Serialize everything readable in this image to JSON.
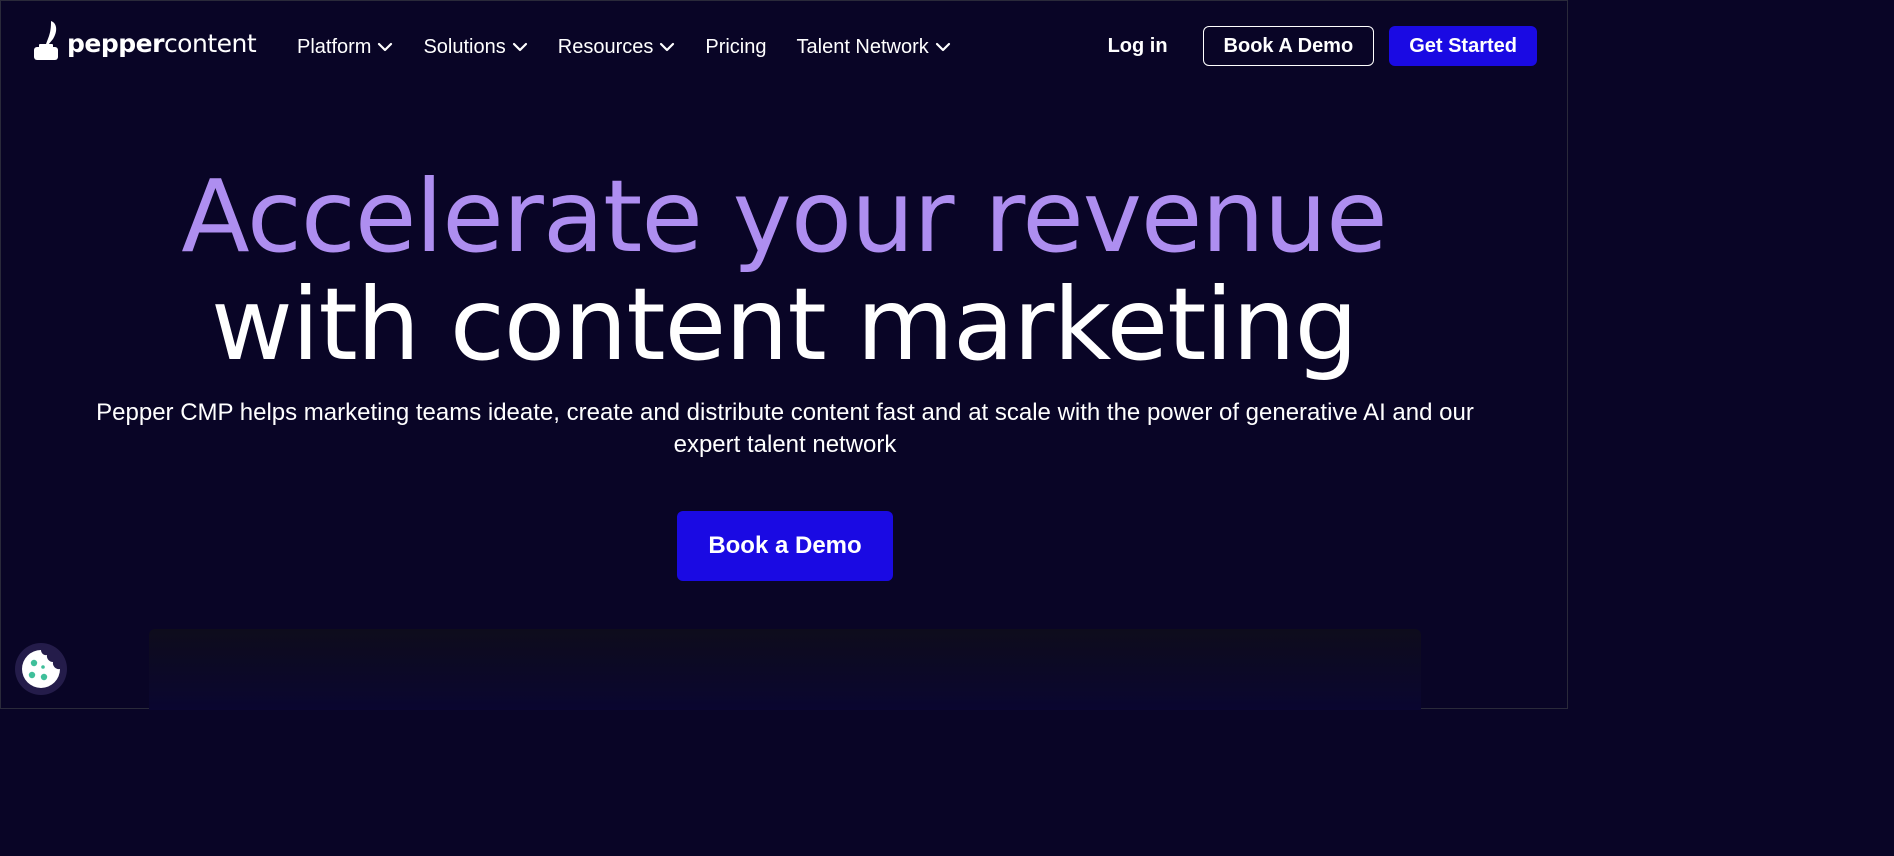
{
  "brand": {
    "name_bold": "pepper",
    "name_light": "content",
    "colors": {
      "background": "#090526",
      "accent_purple": "#ae8ef0",
      "primary_blue": "#1a0ae3"
    }
  },
  "nav": {
    "items": [
      {
        "label": "Platform",
        "has_dropdown": true
      },
      {
        "label": "Solutions",
        "has_dropdown": true
      },
      {
        "label": "Resources",
        "has_dropdown": true
      },
      {
        "label": "Pricing",
        "has_dropdown": false
      },
      {
        "label": "Talent Network",
        "has_dropdown": true
      }
    ],
    "login_label": "Log in",
    "book_demo_label": "Book A Demo",
    "get_started_label": "Get Started"
  },
  "hero": {
    "headline_line1": "Accelerate your revenue",
    "headline_line2": "with content marketing",
    "subheadline": "Pepper CMP helps marketing teams ideate, create and distribute content fast and at scale with the power of generative AI and our expert talent network",
    "cta_label": "Book a Demo"
  },
  "icons": {
    "logo": "inkpot-quill-icon",
    "dropdown": "chevron-down-icon",
    "cookie": "cookie-icon"
  }
}
